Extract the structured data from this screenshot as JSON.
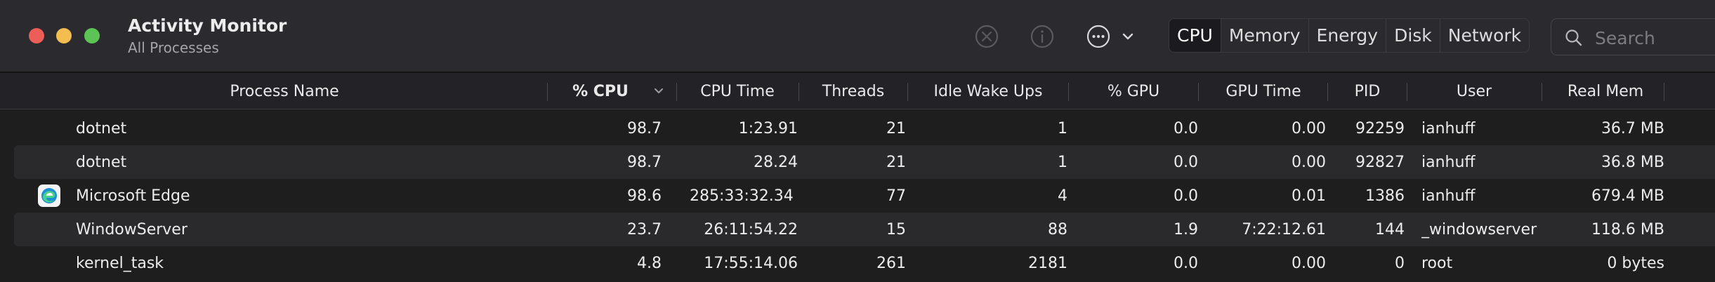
{
  "window": {
    "title": "Activity Monitor",
    "subtitle": "All Processes"
  },
  "toolbar": {
    "stop_icon": "x-circle-icon",
    "info_icon": "info-circle-icon",
    "more_icon": "ellipsis-circle-icon",
    "tabs": [
      {
        "label": "CPU",
        "active": true
      },
      {
        "label": "Memory",
        "active": false
      },
      {
        "label": "Energy",
        "active": false
      },
      {
        "label": "Disk",
        "active": false
      },
      {
        "label": "Network",
        "active": false
      }
    ],
    "search": {
      "placeholder": "Search",
      "value": ""
    }
  },
  "columns": {
    "process_name": "Process Name",
    "cpu": "% CPU",
    "cpu_time": "CPU Time",
    "threads": "Threads",
    "idle_wake_ups": "Idle Wake Ups",
    "gpu": "% GPU",
    "gpu_time": "GPU Time",
    "pid": "PID",
    "user": "User",
    "real_mem": "Real Mem",
    "sorted_by": "% CPU",
    "sort_direction": "descending"
  },
  "rows": [
    {
      "name": "dotnet",
      "icon": "",
      "cpu": "98.7",
      "cpu_time": "1:23.91",
      "threads": "21",
      "idle": "1",
      "gpu": "0.0",
      "gpu_time": "0.00",
      "pid": "92259",
      "user": "ianhuff",
      "mem": "36.7 MB"
    },
    {
      "name": "dotnet",
      "icon": "",
      "cpu": "98.7",
      "cpu_time": "28.24",
      "threads": "21",
      "idle": "1",
      "gpu": "0.0",
      "gpu_time": "0.00",
      "pid": "92827",
      "user": "ianhuff",
      "mem": "36.8 MB"
    },
    {
      "name": "Microsoft Edge",
      "icon": "edge-browser-icon",
      "cpu": "98.6",
      "cpu_time": "285:33:32.34",
      "threads": "77",
      "idle": "4",
      "gpu": "0.0",
      "gpu_time": "0.01",
      "pid": "1386",
      "user": "ianhuff",
      "mem": "679.4 MB"
    },
    {
      "name": "WindowServer",
      "icon": "",
      "cpu": "23.7",
      "cpu_time": "26:11:54.22",
      "threads": "15",
      "idle": "88",
      "gpu": "1.9",
      "gpu_time": "7:22:12.61",
      "pid": "144",
      "user": "_windowserver",
      "mem": "118.6 MB"
    },
    {
      "name": "kernel_task",
      "icon": "",
      "cpu": "4.8",
      "cpu_time": "17:55:14.06",
      "threads": "261",
      "idle": "2181",
      "gpu": "0.0",
      "gpu_time": "0.00",
      "pid": "0",
      "user": "root",
      "mem": "0 bytes"
    }
  ],
  "colors": {
    "accent_close": "#ee5e58",
    "accent_minimize": "#f4bd4f",
    "accent_zoom": "#5cc454",
    "titlebar": "#2b2a2f",
    "row_alt": "#2a2a2d",
    "text": "#ececec"
  }
}
